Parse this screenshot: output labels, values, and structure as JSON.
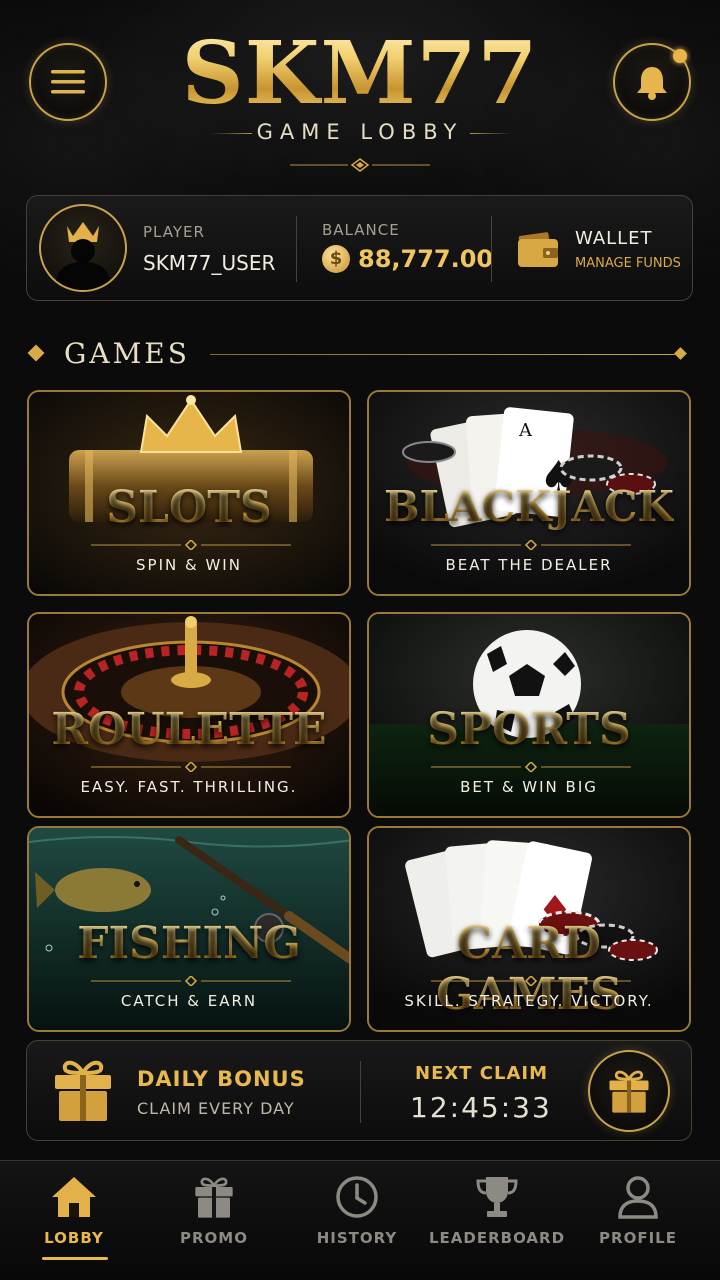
{
  "header": {
    "brand": "SKM77",
    "subtitle": "GAME LOBBY",
    "menu_icon": "hamburger-menu-icon",
    "bell_icon": "bell-icon",
    "has_notification": true
  },
  "player_card": {
    "player_label": "PLAYER",
    "player_name": "SKM77_USER",
    "balance_label": "BALANCE",
    "balance_value": "88,777.00",
    "coin_symbol": "$",
    "wallet_label": "WALLET",
    "wallet_sub": "MANAGE FUNDS"
  },
  "games": {
    "heading": "GAMES",
    "tiles": [
      {
        "title": "SLOTS",
        "subtitle": "SPIN & WIN"
      },
      {
        "title": "BLACKJACK",
        "subtitle": "BEAT THE DEALER"
      },
      {
        "title": "ROULETTE",
        "subtitle": "EASY. FAST. THRILLING."
      },
      {
        "title": "SPORTS",
        "subtitle": "BET & WIN BIG"
      },
      {
        "title": "FISHING",
        "subtitle": "CATCH & EARN"
      },
      {
        "title": "CARD GAMES",
        "subtitle": "SKILL. STRATEGY. VICTORY."
      }
    ]
  },
  "bonus": {
    "title": "DAILY BONUS",
    "subtitle": "CLAIM EVERY DAY",
    "next_label": "NEXT CLAIM",
    "countdown": "12:45:33"
  },
  "nav": {
    "items": [
      {
        "label": "LOBBY",
        "icon": "home-icon",
        "active": true
      },
      {
        "label": "PROMO",
        "icon": "gift-icon",
        "active": false
      },
      {
        "label": "HISTORY",
        "icon": "clock-icon",
        "active": false
      },
      {
        "label": "LEADERBOARD",
        "icon": "trophy-icon",
        "active": false
      },
      {
        "label": "PROFILE",
        "icon": "user-icon",
        "active": false
      }
    ]
  },
  "colors": {
    "background": "#0b0b0b",
    "gold": "#e8b94d",
    "gold_border": "#c9a24a",
    "text": "#f2ece0",
    "muted": "#8d8a83"
  }
}
